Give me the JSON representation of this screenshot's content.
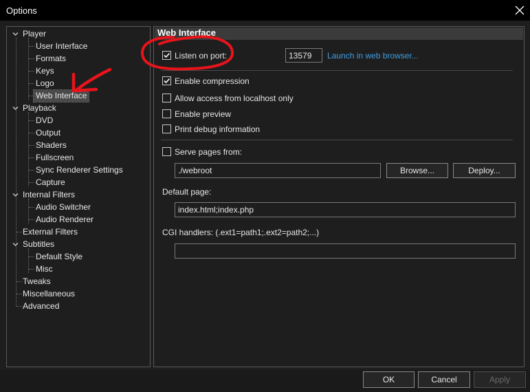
{
  "window": {
    "title": "Options"
  },
  "tree": {
    "items": [
      {
        "label": "Player"
      },
      {
        "label": "User Interface"
      },
      {
        "label": "Formats"
      },
      {
        "label": "Keys"
      },
      {
        "label": "Logo"
      },
      {
        "label": "Web Interface"
      },
      {
        "label": "Playback"
      },
      {
        "label": "DVD"
      },
      {
        "label": "Output"
      },
      {
        "label": "Shaders"
      },
      {
        "label": "Fullscreen"
      },
      {
        "label": "Sync Renderer Settings"
      },
      {
        "label": "Capture"
      },
      {
        "label": "Internal Filters"
      },
      {
        "label": "Audio Switcher"
      },
      {
        "label": "Audio Renderer"
      },
      {
        "label": "External Filters"
      },
      {
        "label": "Subtitles"
      },
      {
        "label": "Default Style"
      },
      {
        "label": "Misc"
      },
      {
        "label": "Tweaks"
      },
      {
        "label": "Miscellaneous"
      },
      {
        "label": "Advanced"
      }
    ],
    "selected": "Web Interface"
  },
  "page": {
    "title": "Web Interface",
    "listen": {
      "label": "Listen on port:",
      "checked": true
    },
    "port": "13579",
    "launch_link": "Launch in web browser...",
    "compression": {
      "label": "Enable compression",
      "checked": true
    },
    "localhost": {
      "label": "Allow access from localhost only",
      "checked": false
    },
    "preview": {
      "label": "Enable preview",
      "checked": false
    },
    "debug": {
      "label": "Print debug information",
      "checked": false
    },
    "serve": {
      "label": "Serve pages from:",
      "checked": false
    },
    "webroot": "./webroot",
    "browse_label": "Browse...",
    "deploy_label": "Deploy...",
    "default_page_label": "Default page:",
    "default_page": "index.html;index.php",
    "cgi_label": "CGI handlers: (.ext1=path1;.ext2=path2;...)",
    "cgi_value": ""
  },
  "buttons": {
    "ok": "OK",
    "cancel": "Cancel",
    "apply": "Apply"
  },
  "annotation_color": "#e8141b"
}
